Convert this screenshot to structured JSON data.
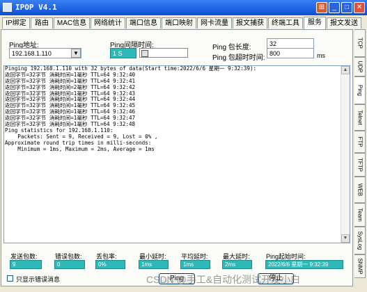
{
  "window": {
    "title": "IPOP V4.1",
    "minimize": "_",
    "maximize": "□",
    "close": "✕"
  },
  "tabs": [
    "IP绑定",
    "路由",
    "MAC信息",
    "网络统计",
    "端口信息",
    "端口映射",
    "网卡流量",
    "报文捕获",
    "终端工具",
    "服务",
    "报文发送"
  ],
  "active_tab": "服务",
  "side_tabs": [
    "TCP",
    "UDP",
    "Ping",
    "Telnet",
    "FTP",
    "TFTP",
    "WEB",
    "Team",
    "SysLog",
    "SNMP"
  ],
  "ping": {
    "address_label": "Ping地址:",
    "address_value": "192.168.1.110",
    "interval_label": "Ping间隔时间:",
    "interval_value": "1 S",
    "size_label": "Ping 包长度:",
    "size_value": "32",
    "timeout_label": "Ping 包超时时间:",
    "timeout_value": "800",
    "timeout_unit": "ms"
  },
  "output_lines": [
    "Pinging 192.168.1.110 with 32 bytes of data(Start time:2022/6/6 星期一 9:32:39):",
    "返回字节=32字节 消耗时间=1毫秒 TTL=64 9:32:40",
    "返回字节=32字节 消耗时间=1毫秒 TTL=64 9:32:41",
    "返回字节=32字节 消耗时间=2毫秒 TTL=64 9:32:42",
    "返回字节=32字节 消耗时间=1毫秒 TTL=64 9:32:43",
    "返回字节=32字节 消耗时间=1毫秒 TTL=64 9:32:44",
    "返回字节=32字节 消耗时间=1毫秒 TTL=64 9:32:45",
    "返回字节=32字节 消耗时间=1毫秒 TTL=64 9:32:46",
    "返回字节=32字节 消耗时间=1毫秒 TTL=64 9:32:47",
    "返回字节=32字节 消耗时间=1毫秒 TTL=64 9:32:48",
    "Ping statistics for 192.168.1.110:",
    "    Packets: Sent = 9, Received = 9, Lost = 0% ,",
    "Approximate round trip times in milli-seconds:",
    "    Minimum = 1ms, Maximum = 2ms, Average = 1ms"
  ],
  "stats": {
    "sent_label": "发送包数:",
    "sent_value": "9",
    "error_label": "错误包数:",
    "error_value": "0",
    "loss_label": "丢包率:",
    "loss_value": "0%",
    "min_label": "最小延时:",
    "min_value": "1ms",
    "avg_label": "平均延时:",
    "avg_value": "1ms",
    "max_label": "最大延时:",
    "max_value": "2ms",
    "start_label": "Ping起始时间:",
    "start_value": "2022/6/6 星期一 9:32:39"
  },
  "show_errors_only_label": "只显示错误消息",
  "start_button": "Ping",
  "stop_button": "停止",
  "watermark": "CSDN @手工&自动化测试开发小白"
}
